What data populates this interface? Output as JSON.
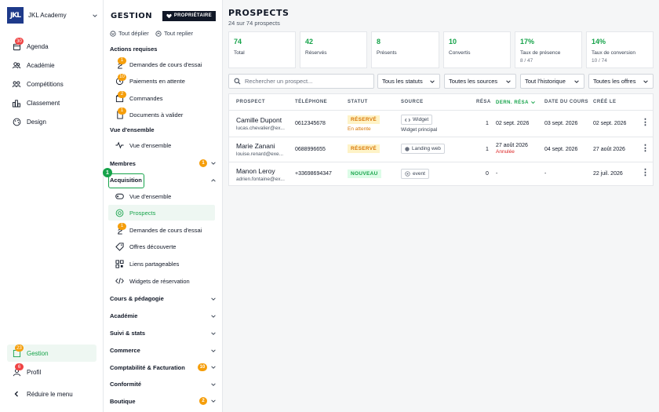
{
  "brand": {
    "logo_text": "JKL",
    "name": "JKL Academy"
  },
  "rail": {
    "items": [
      {
        "label": "Agenda",
        "badge": "30"
      },
      {
        "label": "Académie"
      },
      {
        "label": "Compétitions"
      },
      {
        "label": "Classement"
      },
      {
        "label": "Design"
      }
    ],
    "bottom": [
      {
        "label": "Gestion",
        "badge": "23"
      },
      {
        "label": "Profil",
        "badge": "6"
      },
      {
        "label": "Réduire le menu"
      }
    ]
  },
  "mid": {
    "title": "GESTION",
    "owner_label": "PROPRIÉTAIRE",
    "expand_all": "Tout déplier",
    "collapse_all": "Tout replier",
    "actions_title": "Actions requises",
    "actions": [
      {
        "label": "Demandes de cours d'essai",
        "badge": "1"
      },
      {
        "label": "Paiements en attente",
        "badge": "10"
      },
      {
        "label": "Commandes",
        "badge": "2"
      },
      {
        "label": "Documents à valider",
        "badge": "1"
      }
    ],
    "overview_title": "Vue d'ensemble",
    "overview_item": "Vue d'ensemble",
    "membres": {
      "label": "Membres",
      "badge": "1"
    },
    "acquisition": {
      "label": "Acquisition",
      "step": "1"
    },
    "acq_items": [
      {
        "label": "Vue d'ensemble"
      },
      {
        "label": "Prospects"
      },
      {
        "label": "Demandes de cours d'essai",
        "badge": "1"
      },
      {
        "label": "Offres découverte"
      },
      {
        "label": "Liens partageables"
      },
      {
        "label": "Widgets de réservation"
      }
    ],
    "sections": [
      {
        "label": "Cours & pédagogie"
      },
      {
        "label": "Académie"
      },
      {
        "label": "Suivi & stats"
      },
      {
        "label": "Commerce"
      },
      {
        "label": "Comptabilité & Facturation",
        "badge": "10"
      },
      {
        "label": "Conformité"
      },
      {
        "label": "Boutique",
        "badge": "2"
      }
    ]
  },
  "main": {
    "title": "PROSPECTS",
    "subtitle": "24 sur 74 prospects",
    "kpis": [
      {
        "value": "74",
        "label": "Total",
        "sub": ""
      },
      {
        "value": "42",
        "label": "Réservés",
        "sub": ""
      },
      {
        "value": "8",
        "label": "Présents",
        "sub": ""
      },
      {
        "value": "10",
        "label": "Convertis",
        "sub": ""
      },
      {
        "value": "17%",
        "label": "Taux de présence",
        "sub": "8 / 47"
      },
      {
        "value": "14%",
        "label": "Taux de conversion",
        "sub": "10 / 74"
      }
    ],
    "search_placeholder": "Rechercher un prospect...",
    "filters": [
      "Tous les statuts",
      "Toutes les sources",
      "Tout l'historique",
      "Toutes les offres"
    ],
    "columns": [
      "PROSPECT",
      "TÉLÉPHONE",
      "STATUT",
      "SOURCE",
      "RÉSA",
      "DERN. RÉSA",
      "DATE DU COURS",
      "CRÉÉ LE"
    ],
    "rows": [
      {
        "name": "Camille Dupont",
        "email": "lucas.chevalier@ex...",
        "phone": "0612345678",
        "status": "RÉSERVÉ",
        "status_sub": "En attente",
        "source": "Widget",
        "source_sub": "Widget principal",
        "resa": "1",
        "last_resa": "02 sept. 2026",
        "last_resa_sub": "",
        "course_date": "03 sept. 2026",
        "created": "02 sept. 2026"
      },
      {
        "name": "Marie Zanani",
        "email": "louise.renard@exe...",
        "phone": "0688996655",
        "status": "RÉSERVÉ",
        "status_sub": "",
        "source": "Landing web",
        "source_sub": "",
        "resa": "1",
        "last_resa": "27 août 2026",
        "last_resa_sub": "Annulée",
        "course_date": "04 sept. 2026",
        "created": "27 août 2026"
      },
      {
        "name": "Manon Leroy",
        "email": "adrien.fontaine@ex...",
        "phone": "+33698694347",
        "status": "NOUVEAU",
        "status_sub": "",
        "source": "event",
        "source_sub": "",
        "resa": "0",
        "last_resa": "-",
        "last_resa_sub": "",
        "course_date": "-",
        "created": "22 juil. 2026"
      }
    ]
  }
}
